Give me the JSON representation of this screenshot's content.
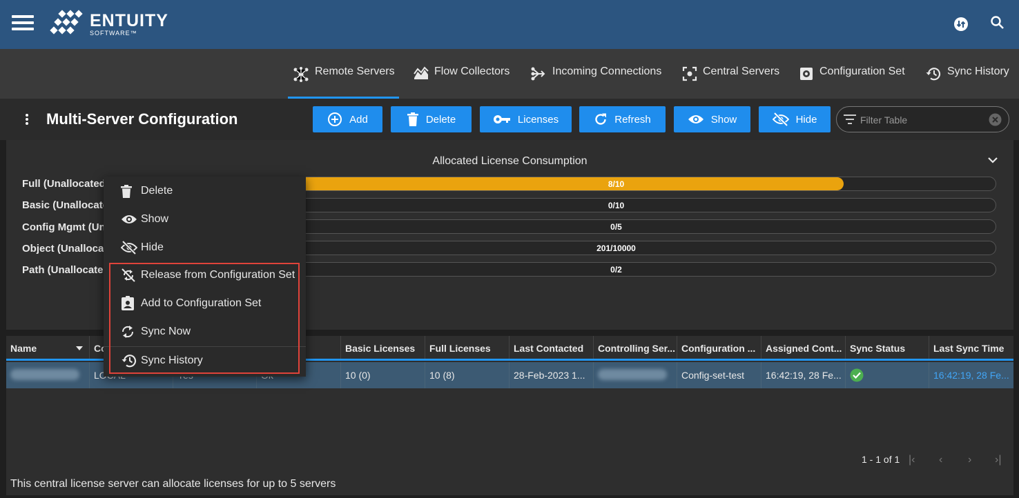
{
  "header": {
    "brand": "ENTUITY",
    "brand_sub": "SOFTWARE™",
    "icons": [
      "menu-icon",
      "sync-status-icon",
      "search-icon"
    ]
  },
  "tabs": [
    {
      "label": "Remote Servers",
      "icon": "remote-servers-icon",
      "active": true
    },
    {
      "label": "Flow Collectors",
      "icon": "flow-collectors-icon",
      "active": false
    },
    {
      "label": "Incoming Connections",
      "icon": "incoming-connections-icon",
      "active": false
    },
    {
      "label": "Central Servers",
      "icon": "central-servers-icon",
      "active": false
    },
    {
      "label": "Configuration Set",
      "icon": "configuration-set-icon",
      "active": false
    },
    {
      "label": "Sync History",
      "icon": "sync-history-icon",
      "active": false
    }
  ],
  "toolbar": {
    "title": "Multi-Server Configuration",
    "buttons": {
      "add": "Add",
      "delete": "Delete",
      "licenses": "Licenses",
      "refresh": "Refresh",
      "show": "Show",
      "hide": "Hide"
    },
    "filter_placeholder": "Filter Table"
  },
  "licenses": {
    "title": "Allocated License Consumption",
    "rows": [
      {
        "label": "Full (Unallocated",
        "text": "8/10",
        "fraction": 0.8
      },
      {
        "label": "Basic (Unallocate",
        "text": "0/10",
        "fraction": 0
      },
      {
        "label": "Config Mgmt (Un",
        "text": "0/5",
        "fraction": 0
      },
      {
        "label": "Object (Unallocat",
        "text": "201/10000",
        "fraction": 0.0201
      },
      {
        "label": "Path (Unallocated",
        "text": "0/2",
        "fraction": 0
      }
    ]
  },
  "table": {
    "columns": [
      "Name",
      "Co",
      "",
      "",
      "Basic Licenses",
      "Full Licenses",
      "Last Contacted",
      "Controlling Ser...",
      "Configuration ...",
      "Assigned Cont...",
      "Sync Status",
      "Last Sync Time"
    ],
    "row": {
      "connection": "LOCAL",
      "col3": "Yes",
      "col4": "Ok",
      "basic": "10 (0)",
      "full": "10 (8)",
      "last_contacted": "28-Feb-2023 1...",
      "config_set": "Config-set-test",
      "assigned": "16:42:19, 28 Fe...",
      "sync_status": "ok",
      "last_sync": "16:42:19, 28 Fe..."
    },
    "pager": "1 - 1 of 1",
    "note": "This central license server can allocate licenses for up to 5 servers"
  },
  "context_menu": {
    "items": [
      {
        "label": "Delete",
        "icon": "trash-icon"
      },
      {
        "label": "Show",
        "icon": "eye-icon"
      },
      {
        "label": "Hide",
        "icon": "eye-off-icon"
      },
      {
        "label": "Release from Configuration Set",
        "icon": "sync-disabled-icon"
      },
      {
        "label": "Add to Configuration Set",
        "icon": "assignment-ind-icon"
      },
      {
        "label": "Sync Now",
        "icon": "sync-icon"
      },
      {
        "label": "Sync History",
        "icon": "history-icon"
      }
    ]
  },
  "colors": {
    "header": "#2c5580",
    "accent": "#1f8ded",
    "bar_fill": "#eaa30e",
    "highlight": "#e0433a",
    "sync_ok": "#4caf50"
  }
}
